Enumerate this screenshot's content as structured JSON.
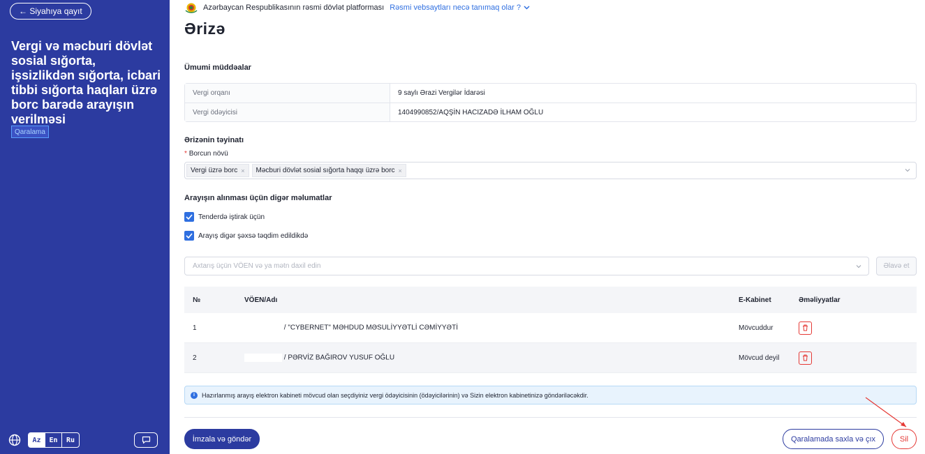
{
  "sidebar": {
    "back_label": "← Siyahıya qayıt",
    "title": "Vergi və məcburi dövlət sosial sığorta, işsizlikdən sığorta, icbari tibbi sığorta haqları üzrə borc barədə arayışın verilməsi",
    "status_badge": "Qaralama",
    "languages": [
      "Az",
      "En",
      "Ru"
    ],
    "active_language": "Az"
  },
  "topbar": {
    "official_text": "Azərbaycan Respublikasının rəsmi dövlət platforması",
    "how_link": "Rəsmi vebsaytları necə tanımaq olar ?"
  },
  "page_title": "Ərizə",
  "general": {
    "section_title": "Ümumi müddəalar",
    "rows": [
      {
        "label": "Vergi orqanı",
        "value": "9 saylı Ərazi Vergilər İdarəsi"
      },
      {
        "label": "Vergi ödəyicisi",
        "value": "1404990852/AQŞİN HACIZADƏ İLHAM OĞLU"
      }
    ]
  },
  "purpose": {
    "section_title": "Ərizənin təyinatı",
    "field_label": "Borcun növü",
    "required_mark": "*",
    "tags": [
      "Vergi üzrə borc",
      "Məcburi dövlət sosial sığorta haqqı üzrə borc"
    ],
    "tag_remove": "×"
  },
  "other_info": {
    "section_title": "Arayışın alınması üçün digər məlumatlar",
    "checkboxes": [
      {
        "label": "Tenderdə iştirak üçün",
        "checked": true
      },
      {
        "label": "Arayış digər şəxsə təqdim edildikdə",
        "checked": true
      }
    ],
    "search_placeholder": "Axtarış üçün VÖEN və ya mətn daxil edin",
    "add_button": "Əlavə et"
  },
  "table": {
    "headers": [
      "№",
      "VÖEN/Adı",
      "E-Kabinet",
      "Əməliyyatlar"
    ],
    "rows": [
      {
        "no": "1",
        "name": "/ \"CYBERNET\" MƏHDUD MƏSULİYYƏTLİ CƏMİYYƏTİ",
        "ekabinet": "Mövcuddur"
      },
      {
        "no": "2",
        "name": "/ PƏRVİZ BAĞIROV YUSUF OĞLU",
        "ekabinet": "Mövcud deyil"
      }
    ]
  },
  "alert": {
    "icon": "i",
    "text": "Hazırlanmış arayış elektron kabineti mövcud olan seçdiyiniz vergi ödəyicisinin (ödəyicilərinin) və Sizin elektron kabinetinizə göndəriləcəkdir."
  },
  "footer": {
    "sign_button": "İmzala və göndər",
    "save_button": "Qaralamada saxla və çıx",
    "delete_button": "Sil"
  },
  "colors": {
    "sidebar_bg": "#2c3ba0",
    "accent": "#2f6fe0",
    "danger": "#e53935"
  }
}
